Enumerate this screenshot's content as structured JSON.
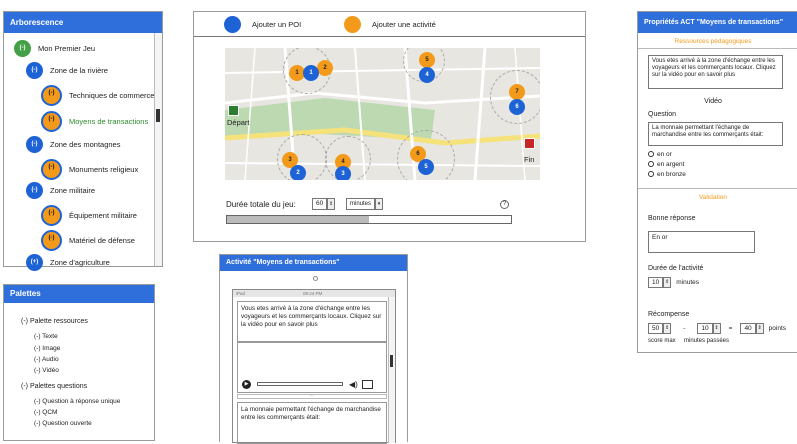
{
  "tree": {
    "title": "Arborescence",
    "items": [
      {
        "symbol": "(-)",
        "label": "Mon Premier Jeu"
      },
      {
        "symbol": "(-)",
        "label": "Zone de la rivière"
      },
      {
        "symbol": "(-)",
        "label": "Techniques de commerce"
      },
      {
        "symbol": "(-)",
        "label": "Moyens de transactions"
      },
      {
        "symbol": "(-)",
        "label": "Zone des montagnes"
      },
      {
        "symbol": "(-)",
        "label": "Monuments religieux"
      },
      {
        "symbol": "(-)",
        "label": "Zone militaire"
      },
      {
        "symbol": "(-)",
        "label": "Équipement militaire"
      },
      {
        "symbol": "(-)",
        "label": "Matériel de défense"
      },
      {
        "symbol": "(+)",
        "label": "Zone d'agriculture"
      }
    ]
  },
  "palettes": {
    "title": "Palettes",
    "resources_header": "(-)   Palette ressources",
    "resources": [
      "(-) Texte",
      "(-) Image",
      "(-) Audio",
      "(-) Vidéo"
    ],
    "questions_header": "(-)   Palettes questions",
    "questions": [
      "(-) Question à réponse unique",
      "(-) QCM",
      "(-) Question ouverte"
    ]
  },
  "map_editor": {
    "add_poi": "Ajouter un POI",
    "add_activity": "Ajouter une activité",
    "start_label": "Départ",
    "end_label": "Fin",
    "duration_label": "Durée totale du jeu:",
    "duration_value": "60",
    "duration_unit": "minutes",
    "help_symbol": "?",
    "progress": 0.5,
    "markers": [
      {
        "n": "1",
        "color": "orange"
      },
      {
        "n": "2",
        "color": "orange"
      },
      {
        "n": "1",
        "color": "blue"
      },
      {
        "n": "5",
        "color": "orange"
      },
      {
        "n": "4",
        "color": "blue"
      },
      {
        "n": "7",
        "color": "orange"
      },
      {
        "n": "6",
        "color": "blue"
      },
      {
        "n": "3",
        "color": "orange"
      },
      {
        "n": "2",
        "color": "blue"
      },
      {
        "n": "4",
        "color": "orange"
      },
      {
        "n": "3",
        "color": "blue"
      },
      {
        "n": "6",
        "color": "orange"
      },
      {
        "n": "5",
        "color": "blue"
      }
    ]
  },
  "activity_preview": {
    "title": "Activité \"Moyens de transactions\"",
    "status_left": "iPad",
    "status_time": "09:24 PM",
    "text": "Vous etes arrivé à la zone d'échange entre les voyageurs et les commerçants locaux. Cliquez sur la vidéo pour en savoir plus",
    "question": "La monnaie permettant l'échange de marchandise entre les commerçants était:"
  },
  "properties": {
    "title": "Propriétés ACT \"Moyens de transactions\"",
    "resources_title": "Ressources pédagogiques",
    "resource_text": "Vous etes arrivé à la zone d'échange entre les voyageurs et les commerçants locaux. Cliquez sur la vidéo pour en savoir plus",
    "video_label": "Vidéo",
    "question_label": "Question",
    "question_text": "La monnaie permettant l'échange de marchandise entre les commerçants était:",
    "options": [
      "en or",
      "en argent",
      "en bronze"
    ],
    "validation_title": "Validation",
    "answer_label": "Bonne réponse",
    "answer_value": "En or",
    "duration_label": "Durée de l'activité",
    "duration_value": "10",
    "duration_unit": "minutes",
    "reward_label": "Récompense",
    "score_max": "50",
    "minus": "-",
    "minutes_passed": "10",
    "equals": "=",
    "result": "40",
    "points_label": "points",
    "score_max_label": "score max",
    "minutes_passed_label": "minutes passées"
  },
  "colors": {
    "accent": "#2f6fdc",
    "orange": "#f39a1a",
    "blue": "#1e63d6",
    "green": "#43a047"
  }
}
